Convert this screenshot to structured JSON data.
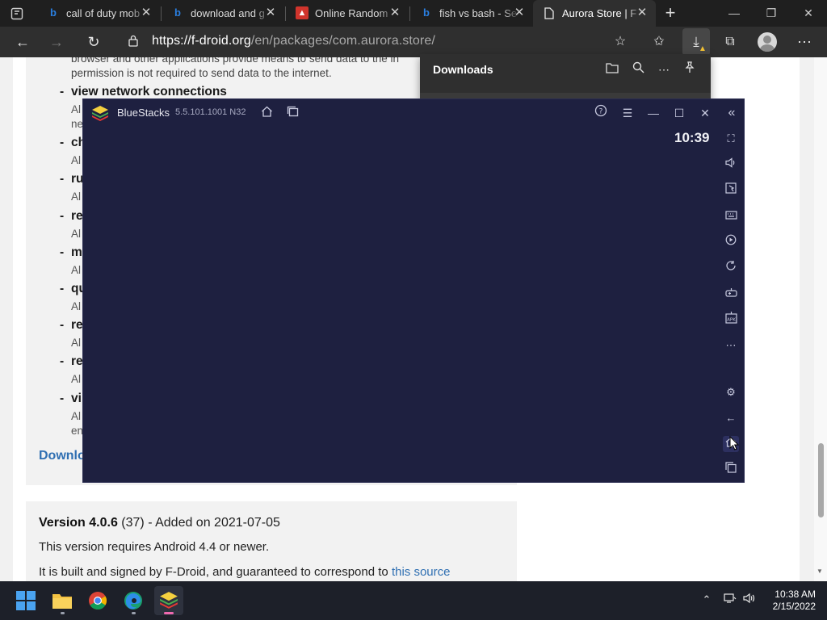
{
  "browser": {
    "tabs": [
      {
        "title": "call of duty mob",
        "icon": "bing-icon"
      },
      {
        "title": "download and g",
        "icon": "bing-icon"
      },
      {
        "title": "Online Random",
        "icon": "random-site-icon"
      },
      {
        "title": "fish vs bash - Se",
        "icon": "bing-icon"
      },
      {
        "title": "Aurora Store | F",
        "icon": "page-icon",
        "active": true
      }
    ],
    "url_host": "https://f-droid.org",
    "url_path": "/en/packages/com.aurora.store/",
    "new_tab_symbol": "+"
  },
  "downloads_panel": {
    "title": "Downloads"
  },
  "page": {
    "intro_line_1": "browser and other applications provide means to send data to the in",
    "intro_line_2": "permission is not required to send data to the internet.",
    "permissions": [
      {
        "name": "view network connections",
        "desc": "Al",
        "desc2": "ne"
      },
      {
        "name": "ch",
        "desc": "Al"
      },
      {
        "name": "ru",
        "desc": "Al"
      },
      {
        "name": "re",
        "desc": "Al"
      },
      {
        "name": "m",
        "desc": "Al"
      },
      {
        "name": "qu",
        "desc": "Al"
      },
      {
        "name": "re",
        "desc": "Al"
      },
      {
        "name": "re",
        "desc": "Al"
      },
      {
        "name": "vi",
        "desc": "Al",
        "desc2": "en"
      }
    ],
    "download_link": "Downlo",
    "version_label": "Version 4.0.6",
    "version_code": "(37)",
    "version_added": "- Added on 2021-07-05",
    "requires": "This version requires Android 4.4 or newer.",
    "built_text": "It is built and signed by F-Droid, and guaranteed to correspond to",
    "built_link": "this source"
  },
  "bluestacks": {
    "name": "BlueStacks",
    "version": "5.5.101.1001 N32",
    "time": "10:39",
    "screen_color": "#1e2040"
  },
  "taskbar": {
    "time": "10:38 AM",
    "date": "2/15/2022"
  },
  "colors": {
    "link": "#2f6fb2",
    "browser_dark": "#1f1f1f",
    "toolbar": "#2f2f2f",
    "bluestacks_bg": "#1e2040",
    "taskbar": "#1d2029"
  }
}
